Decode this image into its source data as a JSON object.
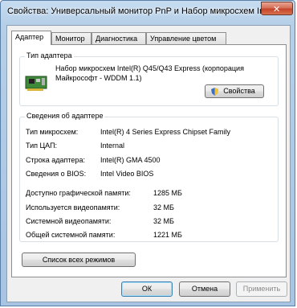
{
  "window": {
    "title": "Свойства: Универсальный монитор PnP и Набор микросхем In..."
  },
  "tabs": [
    "Адаптер",
    "Монитор",
    "Диагностика",
    "Управление цветом"
  ],
  "adapter_type": {
    "group_title": "Тип адаптера",
    "line1": "Набор микросхем Intel(R) Q45/Q43 Express (корпорация",
    "line2": "Майкрософт - WDDM 1.1)",
    "properties_button": "Свойства"
  },
  "adapter_info": {
    "group_title": "Сведения об адаптере",
    "rows": [
      {
        "label": "Тип микросхем:",
        "value": "Intel(R) 4 Series Express Chipset Family"
      },
      {
        "label": "Тип ЦАП:",
        "value": "Internal"
      },
      {
        "label": "Строка адаптера:",
        "value": "Intel(R) GMA 4500"
      },
      {
        "label": "Сведения о BIOS:",
        "value": "Intel Video BIOS"
      }
    ],
    "memory": [
      {
        "label": "Доступно графической памяти:",
        "value": "1285 МБ"
      },
      {
        "label": "Используется видеопамяти:",
        "value": "32 МБ"
      },
      {
        "label": "Системной видеопамяти:",
        "value": "32 МБ"
      },
      {
        "label": "Общей системной памяти:",
        "value": "1221 МБ"
      }
    ]
  },
  "list_modes_button": "Список всех режимов",
  "footer": {
    "ok": "ОК",
    "cancel": "Отмена",
    "apply": "Применить"
  }
}
